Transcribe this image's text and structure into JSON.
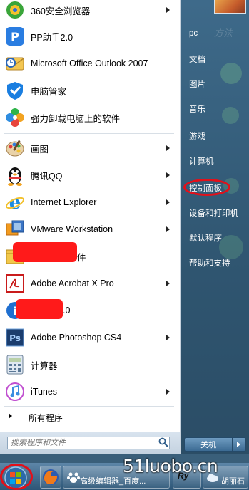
{
  "start_menu": {
    "programs": [
      {
        "label": "360安全浏览器",
        "icon": "browser-360-icon",
        "has_arrow": true
      },
      {
        "label": "PP助手2.0",
        "icon": "pp-assistant-icon",
        "has_arrow": false
      },
      {
        "label": "Microsoft Office Outlook 2007",
        "icon": "outlook-icon",
        "has_arrow": false
      },
      {
        "label": "电脑管家",
        "icon": "pc-manager-shield-icon",
        "has_arrow": false
      },
      {
        "label": "强力卸载电脑上的软件",
        "icon": "uninstaller-flower-icon",
        "has_arrow": false
      },
      {
        "label": "画图",
        "icon": "paint-palette-icon",
        "has_arrow": true
      },
      {
        "label": "腾讯QQ",
        "icon": "qq-penguin-icon",
        "has_arrow": true
      },
      {
        "label": "Internet Explorer",
        "icon": "internet-explorer-icon",
        "has_arrow": true
      },
      {
        "label": "VMware Workstation",
        "icon": "vmware-icon",
        "has_arrow": true
      },
      {
        "label": "件",
        "icon": "folder-icon",
        "has_arrow": false
      },
      {
        "label": "Adobe Acrobat X Pro",
        "icon": "acrobat-icon",
        "has_arrow": true
      },
      {
        "label": ".0",
        "icon": "blue-app-icon",
        "has_arrow": false
      },
      {
        "label": "Adobe Photoshop CS4",
        "icon": "photoshop-icon",
        "has_arrow": true
      },
      {
        "label": "计算器",
        "icon": "calculator-icon",
        "has_arrow": false
      },
      {
        "label": "iTunes",
        "icon": "itunes-icon",
        "has_arrow": true
      }
    ],
    "all_programs": "所有程序",
    "search_placeholder": "搜索程序和文件",
    "right_items": [
      "pc",
      "文档",
      "图片",
      "音乐",
      "游戏",
      "计算机",
      "控制面板",
      "设备和打印机",
      "默认程序",
      "帮助和支持"
    ],
    "shutdown_label": "关机",
    "faded_text": "方法"
  },
  "taskbar": {
    "items": [
      {
        "label": "高级编辑器_百度..."
      },
      {
        "label": "胡丽石"
      }
    ],
    "watermark": "51luobo.cn"
  },
  "colors": {
    "highlight_red": "#e2101a",
    "right_pane": "#2f5570",
    "taskbar": "#2d5677"
  }
}
